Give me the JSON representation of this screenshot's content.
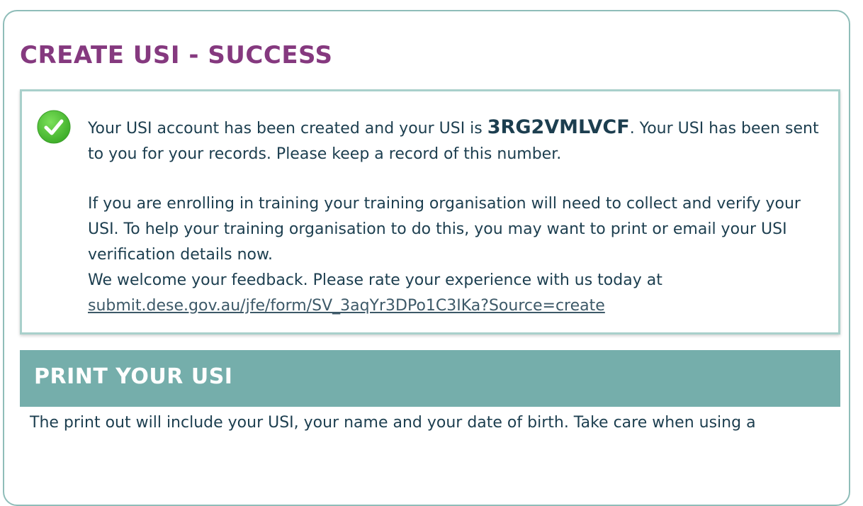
{
  "page": {
    "title": "CREATE USI - SUCCESS"
  },
  "success": {
    "icon": "check-circle-icon",
    "icon_color": "#5cc43c",
    "msg_prefix": "Your USI account has been created and your USI is ",
    "usi": "3RG2VMLVCF",
    "msg_suffix": ". Your USI has been sent to you for your records. Please keep a record of this number.",
    "paragraph2": "If you are enrolling in training your training organisation will need to collect and verify your USI. To help your training organisation to do this, you may want to print or email your USI verification details now.",
    "feedback_text": "We welcome your feedback. Please rate your experience with us today at",
    "feedback_link": "submit.dese.gov.au/jfe/form/SV_3aqYr3DPo1C3IKa?Source=create"
  },
  "print_section": {
    "title": "PRINT YOUR USI",
    "description": "The print out will include your USI, your name and your date of birth. Take care when using a"
  },
  "colors": {
    "title_purple": "#85397f",
    "header_teal": "#75aeab",
    "border_teal": "#a9d0cb",
    "text_navy": "#1c3e4f"
  }
}
